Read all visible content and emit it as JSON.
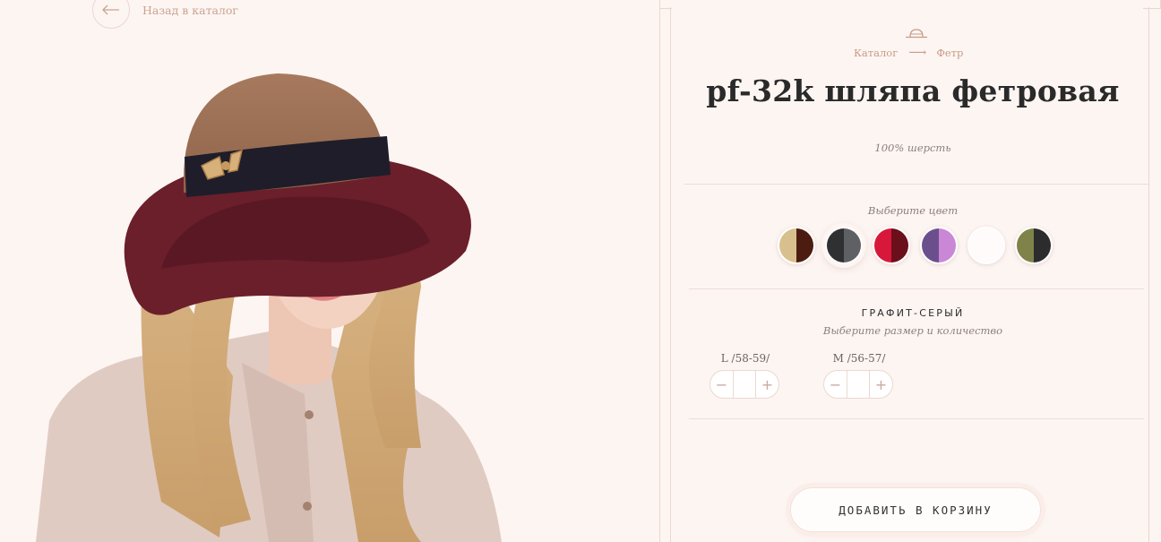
{
  "nav": {
    "back_label": "Назад в каталог"
  },
  "breadcrumb": {
    "catalog": "Каталог",
    "arrow": "⟶",
    "category": "Фетр"
  },
  "product": {
    "title": "pf-32k шляпа фетровая",
    "material": "100% шерсть"
  },
  "colors": {
    "label": "Выберите цвет",
    "selected_index": 1,
    "swatches": [
      {
        "name": "beige-brown",
        "colors": [
          "#d8c08e",
          "#4c1c10"
        ]
      },
      {
        "name": "graphite-grey",
        "colors": [
          "#2f3032",
          "#5f6063"
        ]
      },
      {
        "name": "red-burgundy",
        "colors": [
          "#d8183a",
          "#6b0f1a"
        ]
      },
      {
        "name": "purple-lilac",
        "colors": [
          "#6b4f8c",
          "#c987d6"
        ]
      },
      {
        "name": "white",
        "colors": [
          "#fefbfa",
          "#fefbfa"
        ]
      },
      {
        "name": "olive-black",
        "colors": [
          "#7f8349",
          "#2c2c2c"
        ]
      }
    ]
  },
  "selection": {
    "color_name": "ГРАФИТ-СЕРЫЙ",
    "size_hint": "Выберите размер и количество"
  },
  "sizes": [
    {
      "label": "L /58-59/",
      "minus": "−",
      "plus": "+",
      "value": ""
    },
    {
      "label": "M /56-57/",
      "minus": "−",
      "plus": "+",
      "value": ""
    }
  ],
  "cart": {
    "button_label": "ДОБАВИТЬ В КОРЗИНУ"
  },
  "accent_colors": {
    "background": "#fdf5f2",
    "line": "#ecdcd6",
    "accent": "#c79b86"
  }
}
